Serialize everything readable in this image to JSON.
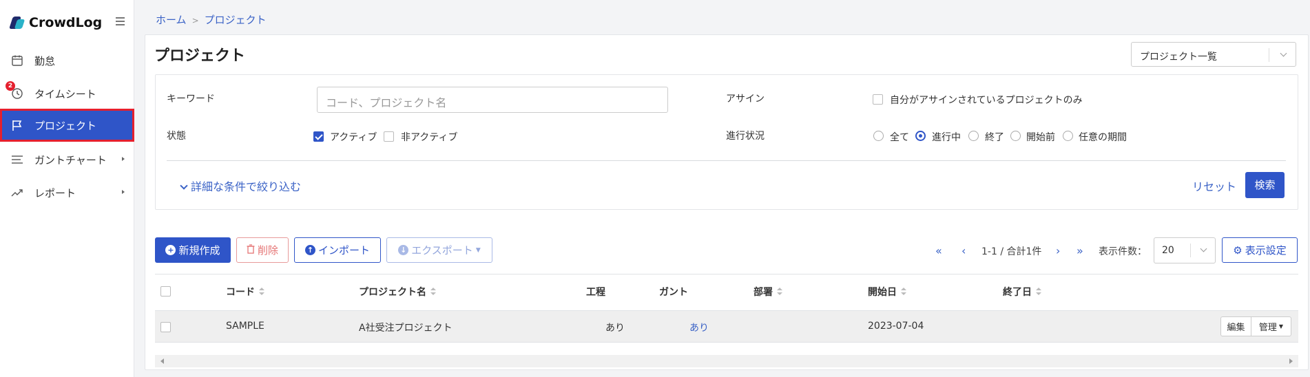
{
  "app": {
    "name": "CrowdLog"
  },
  "sidebar": {
    "items": [
      {
        "label": "勤怠",
        "icon": "calendar-icon"
      },
      {
        "label": "タイムシート",
        "icon": "clock-icon",
        "badge": "2"
      },
      {
        "label": "プロジェクト",
        "icon": "flag-icon",
        "active": true
      },
      {
        "label": "ガントチャート",
        "icon": "gantt-icon"
      },
      {
        "label": "レポート",
        "icon": "trend-icon"
      }
    ]
  },
  "breadcrumb": {
    "home": "ホーム",
    "sep": ">",
    "current": "プロジェクト"
  },
  "page": {
    "title": "プロジェクト",
    "view_select": "プロジェクト一覧"
  },
  "filter": {
    "keyword_label": "キーワード",
    "keyword_placeholder": "コード、プロジェクト名",
    "keyword_value": "",
    "assign_label": "アサイン",
    "assign_option": "自分がアサインされているプロジェクトのみ",
    "assign_checked": false,
    "status_label": "状態",
    "status_active": "アクティブ",
    "status_active_checked": true,
    "status_inactive": "非アクティブ",
    "status_inactive_checked": false,
    "progress_label": "進行状況",
    "progress_options": [
      "全て",
      "進行中",
      "終了",
      "開始前",
      "任意の期間"
    ],
    "progress_selected": "進行中",
    "more_conditions": "詳細な条件で絞り込む",
    "reset": "リセット",
    "search": "検索"
  },
  "toolbar": {
    "new": "新規作成",
    "delete": "削除",
    "import": "インポート",
    "export": "エクスポート",
    "pagination": "1-1 / 合計1件",
    "per_page_label": "表示件数：",
    "per_page_value": "20",
    "display_settings": "表示設定"
  },
  "table": {
    "headers": [
      "コード",
      "プロジェクト名",
      "工程",
      "ガント",
      "部署",
      "開始日",
      "終了日"
    ],
    "rows": [
      {
        "code": "SAMPLE",
        "name": "A社受注プロジェクト",
        "process": "あり",
        "gantt": "あり",
        "dept": "",
        "start": "2023-07-04",
        "end": "",
        "edit": "編集",
        "manage": "管理"
      }
    ]
  },
  "colors": {
    "accent": "#2f55c8",
    "danger": "#e5202e",
    "link": "#3a62c6"
  }
}
